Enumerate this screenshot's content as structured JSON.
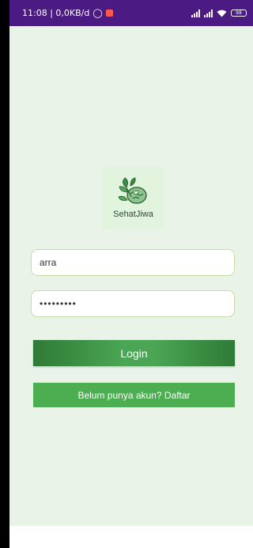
{
  "status_bar": {
    "time_and_speed": "11:08 | 0,0KB/d",
    "battery_level": "98"
  },
  "logo": {
    "name": "SehatJiwa",
    "icon": "brain-leaf-icon"
  },
  "form": {
    "username_value": "arra",
    "password_value": "•••••••••",
    "login_label": "Login",
    "register_label": "Belum punya akun? Daftar"
  },
  "colors": {
    "status_bar": "#4b1a82",
    "background": "#e9f3e8",
    "button_green": "#4cae50"
  }
}
